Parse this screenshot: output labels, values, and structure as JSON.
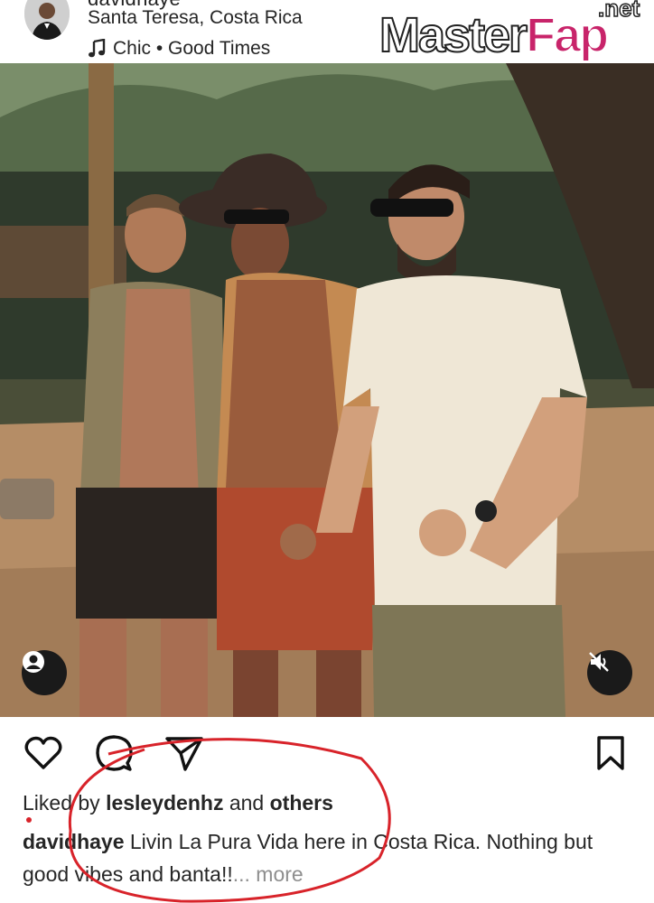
{
  "post": {
    "username_peek": "davidhaye",
    "location": "Santa Teresa, Costa Rica",
    "music": "Chic • Good Times",
    "likes": {
      "prefix": "Liked by",
      "user": "lesleydenhz",
      "middle": "and",
      "others": "others"
    },
    "caption": {
      "username": "davidhaye",
      "text": "Livin La Pura Vida here in Costa Rica. Nothing but good vibes and banta!!",
      "more": "... more"
    }
  },
  "watermark": {
    "main": "Master",
    "accent": "Fap",
    "suffix": ".net"
  },
  "icons": {
    "music": "music-note-icon",
    "tag": "person-tag-icon",
    "mute": "speaker-muted-icon",
    "like": "heart-icon",
    "comment": "comment-bubble-icon",
    "share": "paper-plane-icon",
    "save": "bookmark-icon"
  },
  "colors": {
    "text": "#262626",
    "muted": "#8e8e8e",
    "annotation": "#d8232a"
  }
}
